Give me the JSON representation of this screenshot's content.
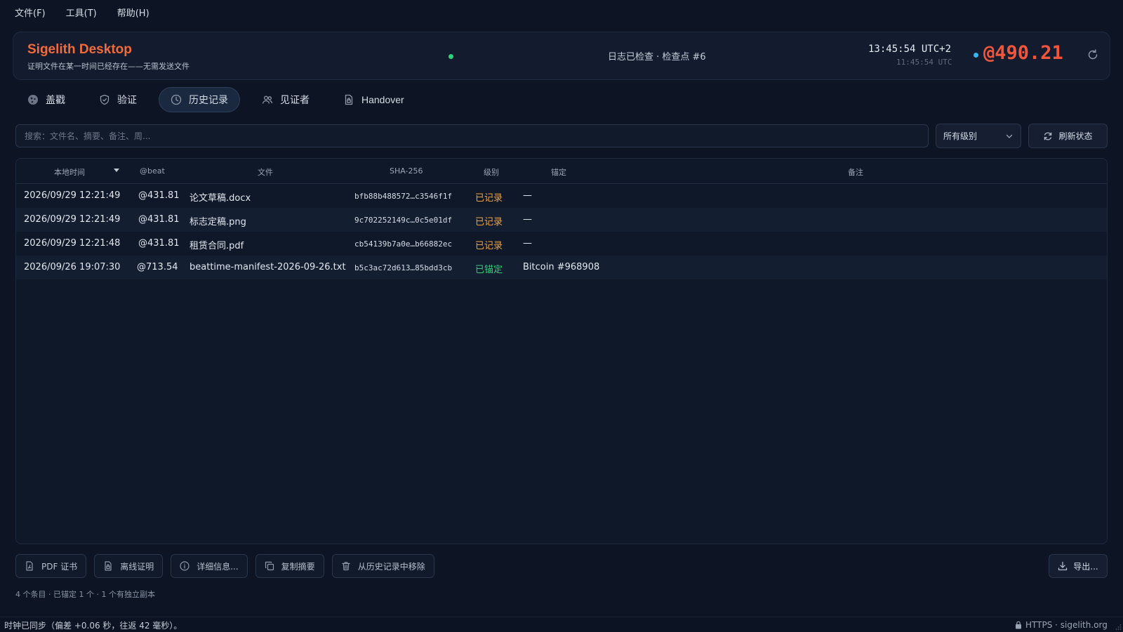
{
  "menu": [
    {
      "label": "文件(F)"
    },
    {
      "label": "工具(T)"
    },
    {
      "label": "帮助(H)"
    }
  ],
  "header": {
    "title": "Sigelith Desktop",
    "subtitle": "证明文件在某一时间已经存在——无需发送文件",
    "log_status": "日志已检查 · 检查点 #6",
    "clock_local": "13:45:54  UTC+2",
    "clock_utc": "11:45:54 UTC",
    "beat": "@490.21",
    "colors": {
      "accent": "#f26b3a",
      "beat": "#f2553a",
      "status_ok": "#2fd07a",
      "beat_dot": "#35b6f0"
    }
  },
  "tabs": [
    {
      "label": "盖戳",
      "icon": "stamp-icon"
    },
    {
      "label": "验证",
      "icon": "shield-check-icon"
    },
    {
      "label": "历史记录",
      "icon": "clock-icon",
      "active": true
    },
    {
      "label": "见证者",
      "icon": "users-icon"
    },
    {
      "label": "Handover",
      "icon": "file-lock-icon"
    }
  ],
  "search": {
    "placeholder": "搜索：文件名、摘要、备注、周..."
  },
  "filter": {
    "selected": "所有级别"
  },
  "refresh_label": "刷新状态",
  "table": {
    "headers": {
      "local_time": "本地时间",
      "beat": "@beat",
      "file": "文件",
      "sha": "SHA-256",
      "level": "级别",
      "anchor": "锚定",
      "note": "备注"
    },
    "rows": [
      {
        "time": "2026/09/29 12:21:49",
        "beat": "@431.81",
        "file": "论文草稿.docx",
        "sha": "bfb88b488572…c3546f1f",
        "level": "已记录",
        "anchor": "—",
        "note": ""
      },
      {
        "time": "2026/09/29 12:21:49",
        "beat": "@431.81",
        "file": "标志定稿.png",
        "sha": "9c702252149c…0c5e01df",
        "level": "已记录",
        "anchor": "—",
        "note": ""
      },
      {
        "time": "2026/09/29 12:21:48",
        "beat": "@431.81",
        "file": "租赁合同.pdf",
        "sha": "cb54139b7a0e…b66882ec",
        "level": "已记录",
        "anchor": "—",
        "note": ""
      },
      {
        "time": "2026/09/26 19:07:30",
        "beat": "@713.54",
        "file": "beattime-manifest-2026-09-26.txt",
        "sha": "b5c3ac72d613…85bdd3cb",
        "level": "已锚定",
        "anchor": "Bitcoin #968908",
        "note": ""
      }
    ],
    "level_colors": {
      "recorded": "#f0a43c",
      "anchored": "#2fd07a"
    }
  },
  "actions": [
    {
      "label": "PDF 证书",
      "icon": "pdf-file-icon"
    },
    {
      "label": "离线证明",
      "icon": "file-lock-icon"
    },
    {
      "label": "详细信息...",
      "icon": "info-icon"
    },
    {
      "label": "复制摘要",
      "icon": "copy-icon"
    },
    {
      "label": "从历史记录中移除",
      "icon": "trash-icon"
    }
  ],
  "export_label": "导出...",
  "summary": "4 个条目 · 已锚定 1 个 · 1 个有独立副本",
  "statusbar": {
    "left": "时钟已同步（偏差 +0.06 秒，往返 42 毫秒）。",
    "right": "HTTPS · sigelith.org"
  }
}
